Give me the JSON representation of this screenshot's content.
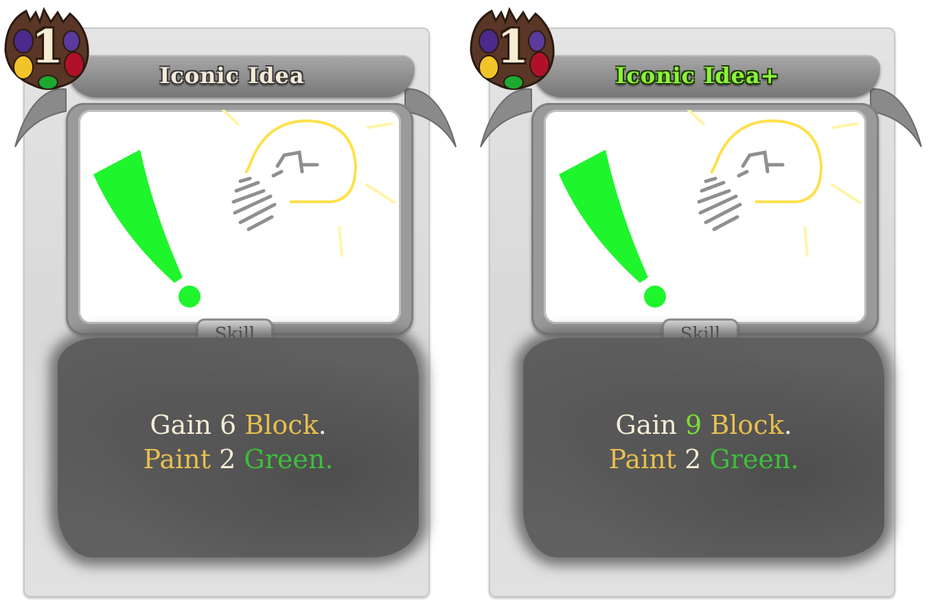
{
  "cards": [
    {
      "cost": "1",
      "title": "Iconic Idea",
      "type": "Skill",
      "desc_line1": {
        "gain": "Gain",
        "amount": "6",
        "block": "Block",
        "period": "."
      },
      "desc_line2": {
        "paint": "Paint",
        "amount": "2",
        "color": "Green."
      }
    },
    {
      "cost": "1",
      "title": "Iconic Idea+",
      "type": "Skill",
      "desc_line1": {
        "gain": "Gain",
        "amount": "9",
        "block": "Block",
        "period": "."
      },
      "desc_line2": {
        "paint": "Paint",
        "amount": "2",
        "color": "Green."
      }
    }
  ],
  "colors": {
    "keyword_yellow": "#e8bf4e",
    "keyword_green": "#3cbf3a",
    "upgraded_value": "#77e033",
    "upgraded_title": "#8cf23a",
    "art_exclamation": "#1ff52c",
    "art_bulb": "#ffe04a"
  },
  "icons": {
    "cost_orb": "paint-palette-icon",
    "art": "lightbulb-exclamation-art"
  }
}
